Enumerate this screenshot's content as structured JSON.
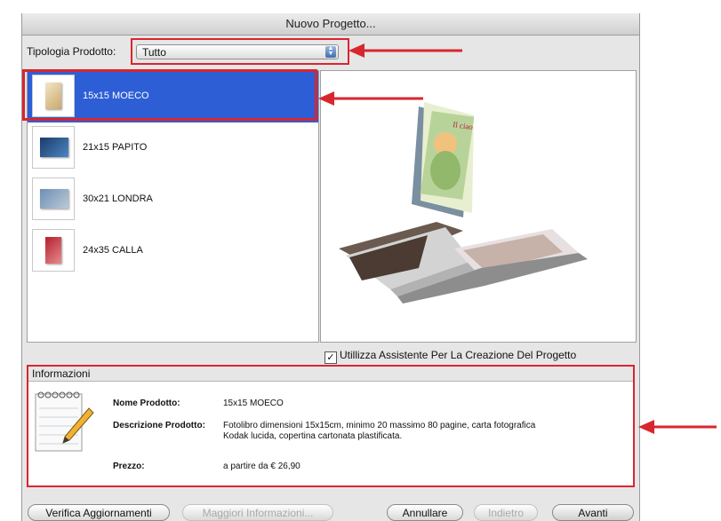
{
  "window": {
    "title": "Nuovo Progetto..."
  },
  "filter": {
    "label": "Tipologia Prodotto:",
    "selected": "Tutto"
  },
  "products": [
    {
      "label": "15x15 MOECO",
      "selected": true
    },
    {
      "label": "21x15 PAPITO",
      "selected": false
    },
    {
      "label": "30x21 LONDRA",
      "selected": false
    },
    {
      "label": "24x35 CALLA",
      "selected": false
    }
  ],
  "preview": {
    "cover_text": "Il ciao"
  },
  "assistant": {
    "label": "Utillizza Assistente Per La Creazione Del Progetto",
    "checked": true
  },
  "info": {
    "title": "Informazioni",
    "name_label": "Nome Prodotto:",
    "name_value": "15x15 MOECO",
    "desc_label": "Descrizione Prodotto:",
    "desc_value": "Fotolibro dimensioni 15x15cm, minimo 20 massimo 80 pagine, carta fotografica Kodak lucida, copertina cartonata plastificata.",
    "price_label": "Prezzo:",
    "price_value": "a partire da € 26,90"
  },
  "buttons": {
    "check_updates": "Verifica Aggiornamenti",
    "more_info": "Maggiori Informazioni...",
    "cancel": "Annullare",
    "back": "Indietro",
    "next": "Avanti"
  },
  "colors": {
    "selection": "#2d5ed6",
    "annotation": "#d8262f"
  }
}
